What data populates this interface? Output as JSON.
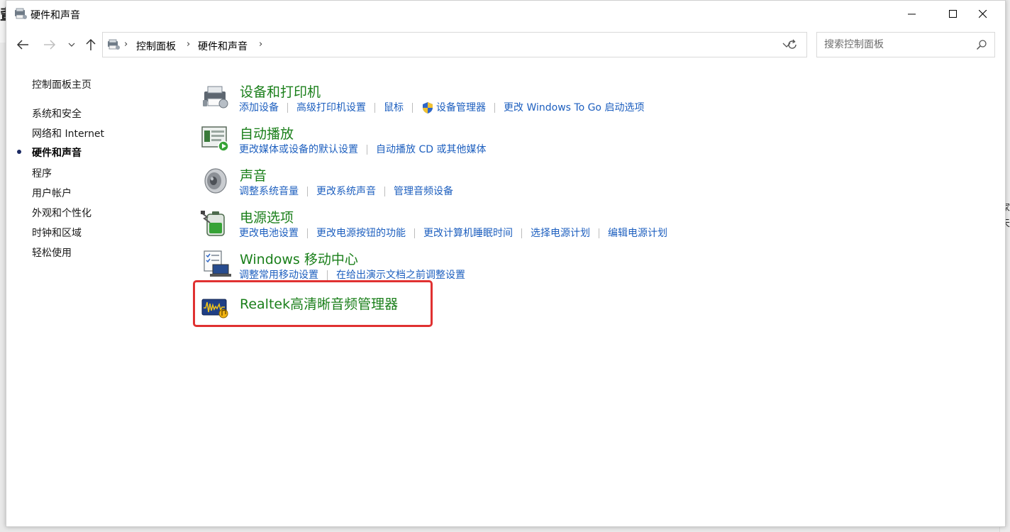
{
  "window": {
    "title": "硬件和声音"
  },
  "nav": {
    "back_label": "←",
    "forward_label": "→",
    "recent_label": "⌄",
    "up_label": "↑"
  },
  "address": {
    "crumbs": [
      "控制面板",
      "硬件和声音"
    ]
  },
  "search": {
    "placeholder": "搜索控制面板"
  },
  "sidebar": {
    "items": [
      {
        "label": "控制面板主页",
        "active": false
      },
      {
        "label": "系统和安全",
        "active": false
      },
      {
        "label": "网络和 Internet",
        "active": false
      },
      {
        "label": "硬件和声音",
        "active": true
      },
      {
        "label": "程序",
        "active": false
      },
      {
        "label": "用户帐户",
        "active": false
      },
      {
        "label": "外观和个性化",
        "active": false
      },
      {
        "label": "时钟和区域",
        "active": false
      },
      {
        "label": "轻松使用",
        "active": false
      }
    ]
  },
  "categories": [
    {
      "title": "设备和打印机",
      "icon": "printer-icon",
      "links": [
        "添加设备",
        "高级打印机设置",
        "鼠标",
        "设备管理器",
        "更改 Windows To Go 启动选项"
      ]
    },
    {
      "title": "自动播放",
      "icon": "autoplay-icon",
      "links": [
        "更改媒体或设备的默认设置",
        "自动播放 CD 或其他媒体"
      ]
    },
    {
      "title": "声音",
      "icon": "speaker-icon",
      "links": [
        "调整系统音量",
        "更改系统声音",
        "管理音频设备"
      ]
    },
    {
      "title": "电源选项",
      "icon": "battery-icon",
      "links": [
        "更改电池设置",
        "更改电源按钮的功能",
        "更改计算机睡眠时间",
        "选择电源计划",
        "编辑电源计划"
      ]
    },
    {
      "title": "Windows 移动中心",
      "icon": "mobility-center-icon",
      "links": [
        "调整常用移动设置",
        "在给出演示文档之前调整设置"
      ]
    },
    {
      "title": "Realtek高清晰音频管理器",
      "icon": "realtek-audio-icon",
      "links": []
    }
  ],
  "background": {
    "glyph_top_left": "軰",
    "glyph_right_1": "家",
    "glyph_right_2": "天"
  },
  "colors": {
    "category_title": "#1a7f1a",
    "link": "#1d5fbf",
    "highlight": "#e03131"
  }
}
